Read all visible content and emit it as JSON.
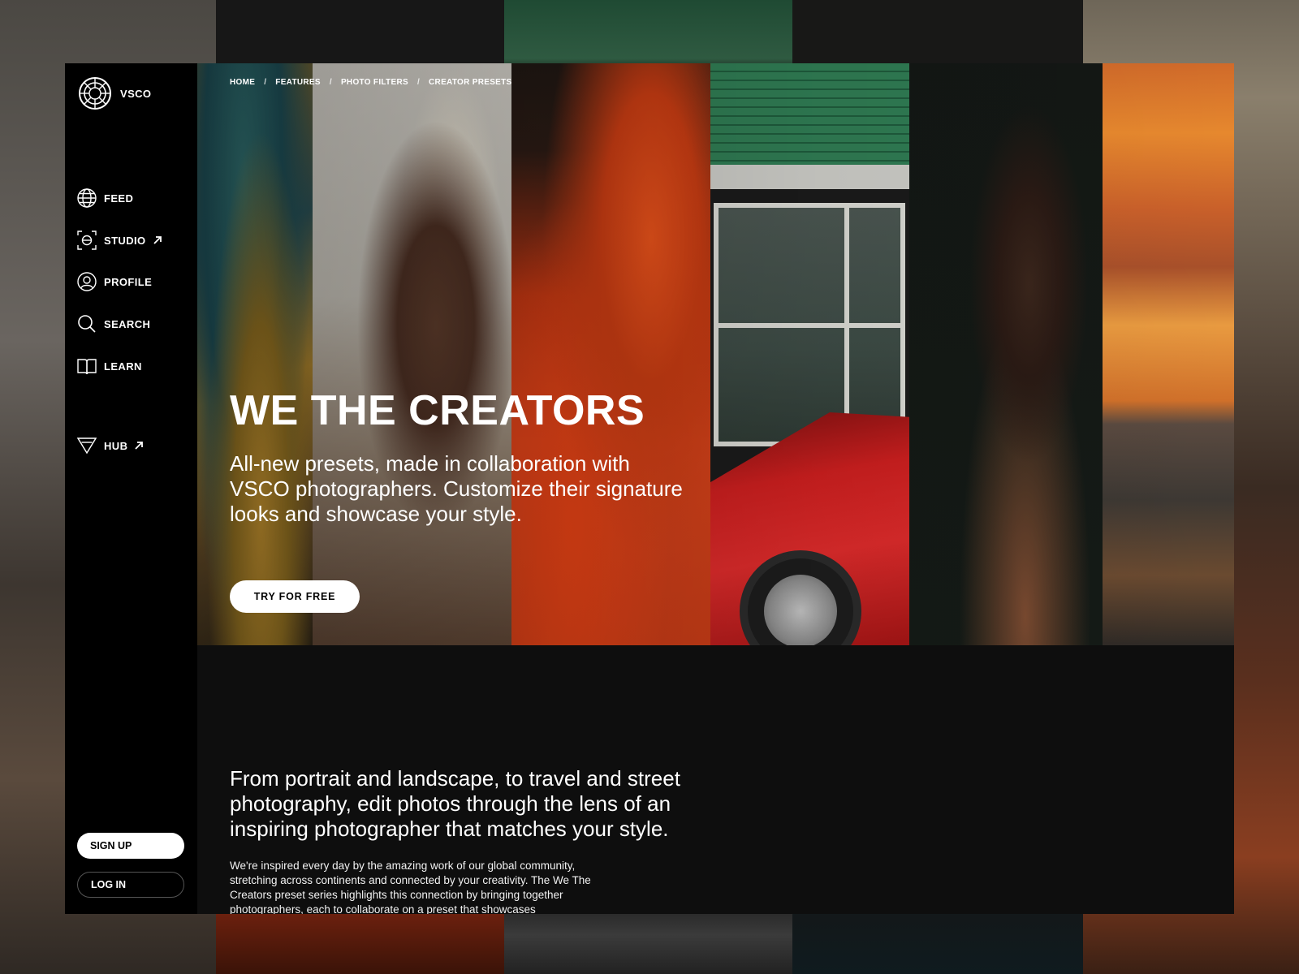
{
  "brand": {
    "name": "VSCO"
  },
  "breadcrumb": {
    "items": [
      "HOME",
      "FEATURES",
      "PHOTO FILTERS",
      "CREATOR PRESETS"
    ],
    "separator": "/"
  },
  "nav": {
    "items": [
      {
        "label": "FEED",
        "icon": "globe-icon"
      },
      {
        "label": "STUDIO",
        "icon": "studio-icon",
        "external": true
      },
      {
        "label": "PROFILE",
        "icon": "profile-icon"
      },
      {
        "label": "SEARCH",
        "icon": "search-icon"
      },
      {
        "label": "LEARN",
        "icon": "book-icon"
      },
      {
        "label": "HUB",
        "icon": "hub-triangle-icon",
        "external": true
      }
    ]
  },
  "auth": {
    "signup_label": "SIGN UP",
    "login_label": "LOG IN"
  },
  "hero": {
    "title": "WE THE CREATORS",
    "subtitle": "All-new presets, made in collaboration with VSCO photographers. Customize their signature looks and showcase your style.",
    "cta_label": "TRY FOR FREE"
  },
  "content": {
    "heading": "From portrait and landscape, to travel and street photography, edit photos through the lens of an inspiring photographer that matches your style.",
    "body": "We're inspired every day by the amazing work of our global community, stretching across continents and connected by your creativity. The We The Creators preset series highlights this connection by bringing together photographers, each to collaborate on a preset that showcases"
  },
  "colors": {
    "sidebar_bg": "#000000",
    "page_bg": "#0e0e0e",
    "button_bg": "#ffffff",
    "text": "#ffffff"
  }
}
